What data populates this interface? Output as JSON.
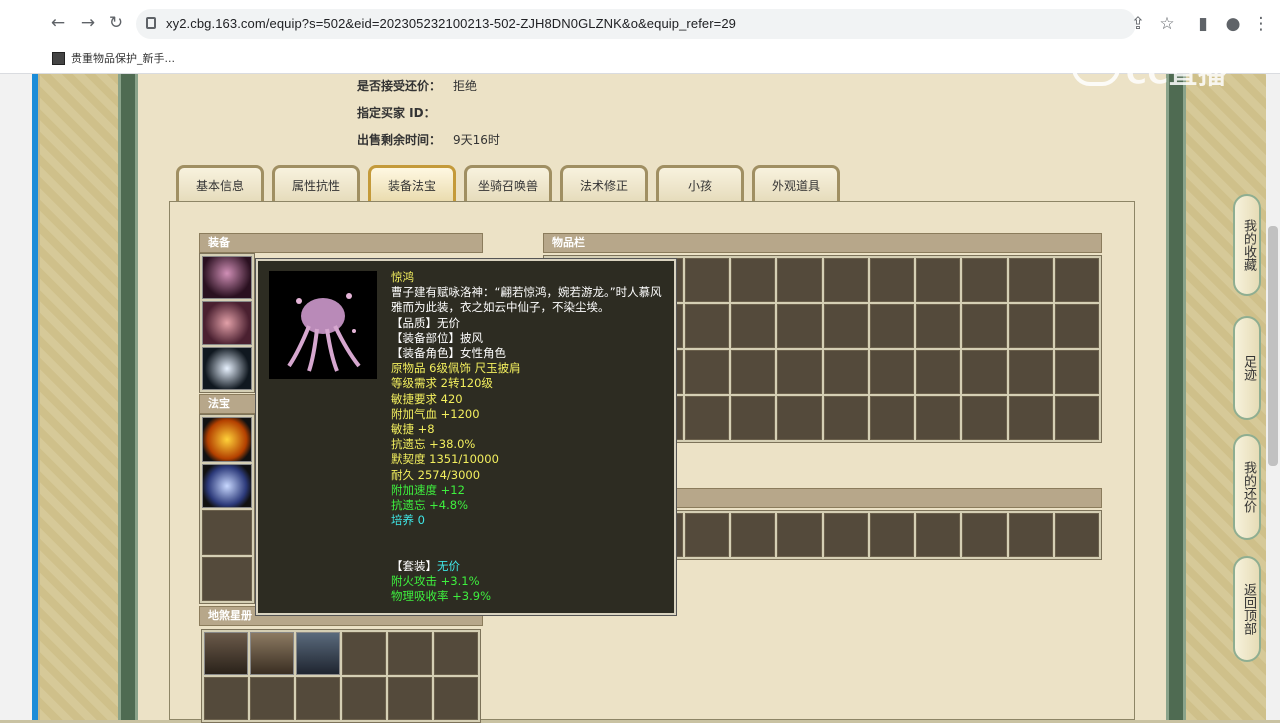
{
  "browser": {
    "url": "xy2.cbg.163.com/equip?s=502&eid=202305232100213-502-ZJH8DN0GLZNK&o&equip_refer=29",
    "bookmark": "贵重物品保护_新手...",
    "back_icon": "←",
    "forward_icon": "→",
    "reload_icon": "↻",
    "share_icon": "⇪",
    "star_icon": "☆",
    "sidepanel_icon": "▮",
    "profile_icon": "●",
    "menu_icon": "⋮"
  },
  "info": {
    "rows": [
      {
        "label": "是否接受还价：",
        "value": "拒绝"
      },
      {
        "label": "指定买家 ID：",
        "value": ""
      },
      {
        "label": "出售剩余时间：",
        "value": "9天16时"
      }
    ]
  },
  "tabs": [
    "基本信息",
    "属性抗性",
    "装备法宝",
    "坐骑召唤兽",
    "法术修正",
    "小孩",
    "外观道具"
  ],
  "sections": {
    "equip": "装备",
    "fabao": "法宝",
    "disha": "地煞星册",
    "inventory": "物品栏"
  },
  "tooltip": {
    "lines": [
      {
        "t": "惊鸿",
        "c": ""
      },
      {
        "t": "曹子建有赋咏洛神：“翩若惊鸿，婉若游龙。”时人慕风雅而为此装，衣之如云中仙子，不染尘埃。",
        "c": "w"
      },
      {
        "t": "【品质】无价",
        "c": "w"
      },
      {
        "t": "【装备部位】披风",
        "c": "w"
      },
      {
        "t": "【装备角色】女性角色",
        "c": "w"
      },
      {
        "t": "原物品 6级佩饰 尺玉披肩",
        "c": ""
      },
      {
        "t": "等级需求 2转120级",
        "c": ""
      },
      {
        "t": "敏捷要求 420",
        "c": ""
      },
      {
        "t": "附加气血 +1200",
        "c": ""
      },
      {
        "t": "敏捷 +8",
        "c": ""
      },
      {
        "t": "抗遗忘 +38.0%",
        "c": ""
      },
      {
        "t": "默契度 1351/10000",
        "c": ""
      },
      {
        "t": "耐久 2574/3000",
        "c": ""
      },
      {
        "t": "附加速度 +12",
        "c": "g"
      },
      {
        "t": "抗遗忘 +4.8%",
        "c": "g"
      },
      {
        "t": "培养 0",
        "c": "c"
      },
      {
        "t": " ",
        "c": ""
      },
      {
        "t": " ",
        "c": ""
      },
      {
        "t": "【套装】无价",
        "c": "suit"
      },
      {
        "t": "附火攻击 +3.1%",
        "c": "g"
      },
      {
        "t": "物理吸收率 +3.9%",
        "c": "g"
      }
    ]
  },
  "side": [
    "我的收藏",
    "足迹",
    "我的还价",
    "返回顶部"
  ],
  "watermark": "CC直播"
}
